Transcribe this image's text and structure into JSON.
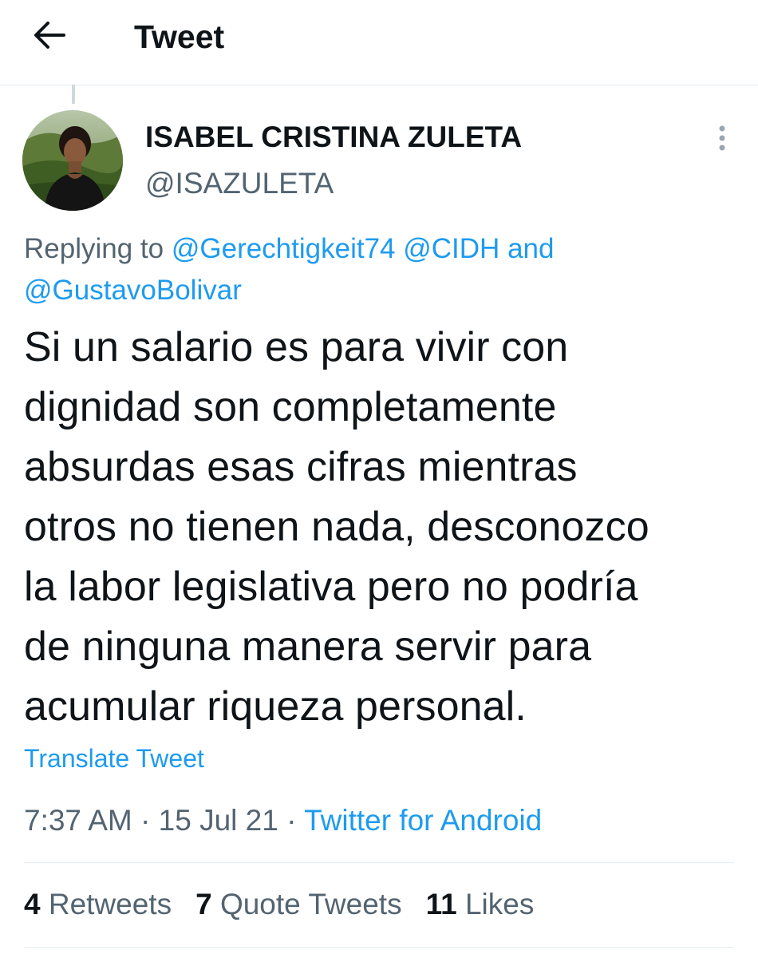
{
  "header": {
    "back_icon": "arrow-left-icon",
    "title": "Tweet"
  },
  "tweet": {
    "author": {
      "display_name": "ISABEL CRISTINA ZULETA",
      "handle": "@ISAZULETA",
      "avatar": "profile-photo"
    },
    "more_icon": "more-vertical-icon",
    "reply_prefix": "Replying to",
    "reply_mentions": [
      "@Gerechtigkeit74",
      "@CIDH"
    ],
    "reply_conjunction": "and",
    "reply_last_mention": "@GustavoBolivar",
    "text_lines": [
      "Si un salario es para vivir con",
      "dignidad son completamente",
      "absurdas esas cifras mientras",
      "otros no tienen nada, desconozco",
      "la labor legislativa pero no podría",
      "de ninguna manera servir para",
      "acumular riqueza personal."
    ],
    "translate_label": "Translate Tweet",
    "time": "7:37 AM",
    "date": "15 Jul 21",
    "separator": "·",
    "source": "Twitter for Android",
    "stats": {
      "retweets_count": "4",
      "retweets_label": "Retweets",
      "quote_count": "7",
      "quote_label": "Quote Tweets",
      "likes_count": "11",
      "likes_label": "Likes"
    }
  },
  "colors": {
    "text_primary": "#0f1419",
    "text_secondary": "#536471",
    "accent": "#1d9bf0",
    "divider": "#e6ecf0"
  }
}
